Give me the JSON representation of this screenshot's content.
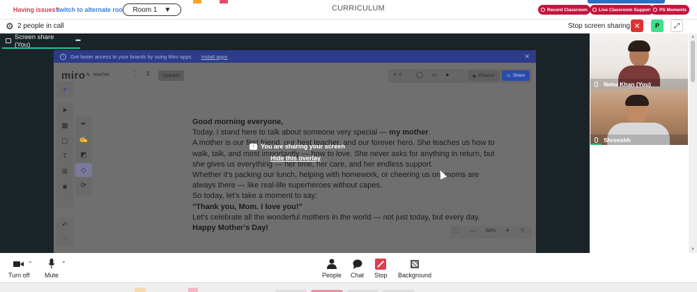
{
  "topbar": {
    "issue_text": "Having issues?",
    "issue_link": "switch to alternate room",
    "room": "Room 1",
    "room_caret": "▼",
    "curriculum": "CURRICULUM",
    "buttons": [
      {
        "label": "Record Classroom"
      },
      {
        "label": "Live Classroom Support"
      },
      {
        "label": "PS Moments"
      }
    ],
    "colors": {
      "pill": "#c3163d",
      "link": "#3d7fd9",
      "issue": "#d23a4a"
    }
  },
  "callbar": {
    "gear_icon": "⚙",
    "people_count": "2 people in call",
    "stop_sharing": "Stop screen sharing",
    "stop_icon": "✕",
    "avatar_letter": "P",
    "expand_icon": "⤢"
  },
  "stage": {
    "tab_label": "Screen share (You)",
    "tab_more": "•••"
  },
  "miro": {
    "banner_text": "Get faster access to your boards by using Miro apps.",
    "banner_link": "Install apps",
    "banner_close": "✕",
    "logo": "miro",
    "board_name": "teacher",
    "menu_icon": "⋮",
    "upload_icon": "⇪",
    "upgrade": "Upgrade",
    "present": "Present",
    "share": "Share",
    "zoom": "68%",
    "zoom_minus": "—",
    "zoom_plus": "+",
    "help": "?"
  },
  "document": {
    "lines": [
      {
        "text": "Good morning everyone,",
        "bold": true
      },
      {
        "text": "Today, I stand here to talk about someone very special — ",
        "bold": false,
        "tail": "my mother",
        "tail_bold": true,
        "end": "."
      },
      {
        "text": "A mother is our first friend, our best teacher, and our forever hero. She teaches us how to",
        "bold": false
      },
      {
        "text": "walk, talk, and most importantly — how to love. She never asks for anything in return, but",
        "bold": false
      },
      {
        "text": "she gives us everything — her time, her care, and her endless support.",
        "bold": false
      },
      {
        "text": "Whether it's packing our lunch, helping with homework, or cheering us on, moms are",
        "bold": false
      },
      {
        "text": "always there — like real-life superheroes without capes.",
        "bold": false
      },
      {
        "text": "So today, let's take a moment to say:",
        "bold": false
      },
      {
        "text": "\"Thank you, Mom. I love you!\"",
        "bold": true
      },
      {
        "text": "Let's celebrate all the wonderful mothers in the world — not just today, but every day.",
        "bold": false
      },
      {
        "text": "Happy Mother's Day!",
        "bold": true
      }
    ]
  },
  "overlay": {
    "message": "You are sharing your screen",
    "hide": "Hide this overlay"
  },
  "participants": [
    {
      "name": "Neha Khan (You)"
    },
    {
      "name": "Shreeshh"
    }
  ],
  "controls": {
    "turn_off": "Turn off",
    "mute": "Mute",
    "people": "People",
    "chat": "Chat",
    "stop": "Stop",
    "background": "Background"
  }
}
